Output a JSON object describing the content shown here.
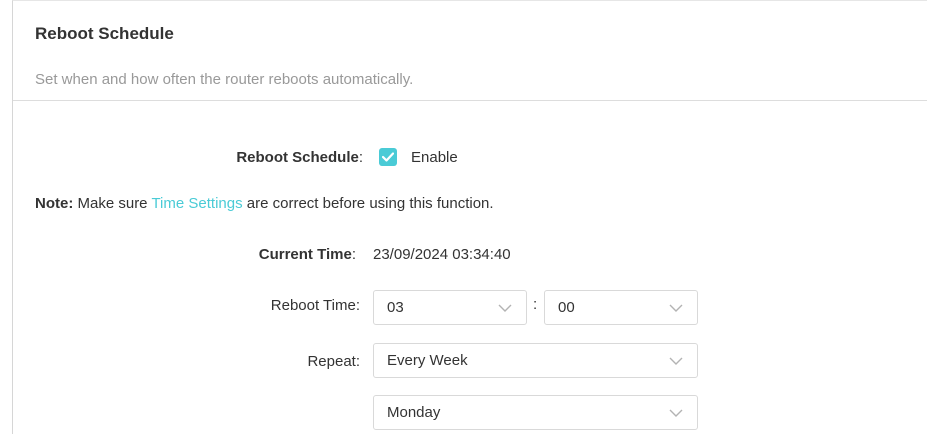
{
  "section": {
    "title": "Reboot Schedule",
    "description": "Set when and how often the router reboots automatically."
  },
  "reboot_schedule": {
    "label": "Reboot Schedule",
    "colon": ":",
    "checkbox_checked": true,
    "enable_label": "Enable"
  },
  "note": {
    "prefix": "Note:",
    "text_before": "Make sure ",
    "link_text": "Time Settings",
    "text_after": " are correct before using this function."
  },
  "current_time": {
    "label": "Current Time",
    "colon": ":",
    "value": "23/09/2024 03:34:40"
  },
  "reboot_time": {
    "label": "Reboot Time:",
    "hour": "03",
    "separator": ":",
    "minute": "00"
  },
  "repeat": {
    "label": "Repeat:",
    "frequency": "Every Week",
    "day": "Monday"
  },
  "colors": {
    "accent": "#4acbd6",
    "text": "#333333",
    "muted": "#999999",
    "border": "#d9d9d9"
  },
  "icons": {
    "checkbox": "check-icon",
    "dropdown": "chevron-down-icon"
  }
}
